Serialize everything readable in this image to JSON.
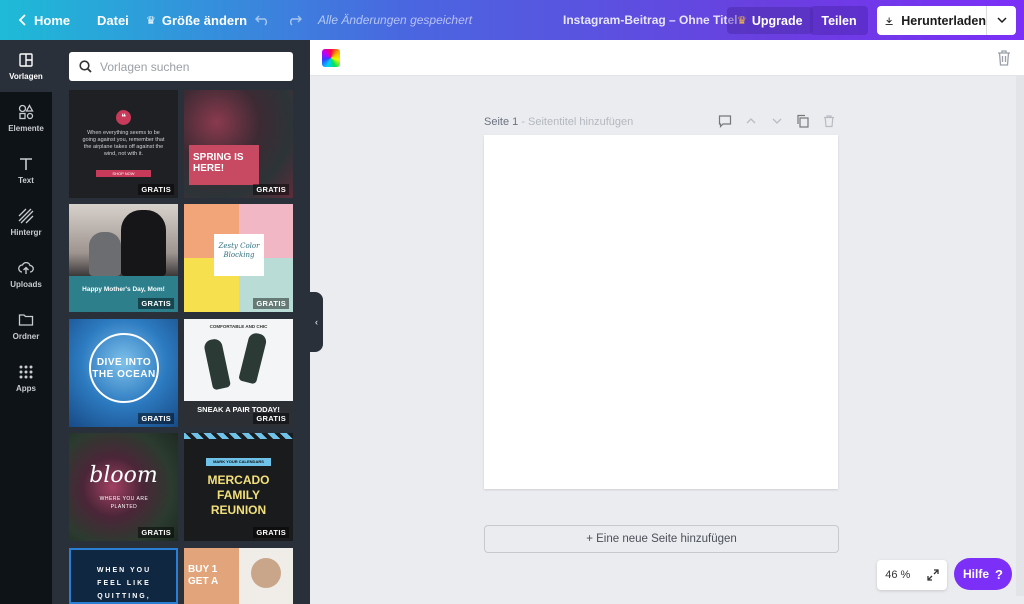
{
  "topbar": {
    "home_label": "Home",
    "file_label": "Datei",
    "resize_label": "Größe ändern",
    "saved_status": "Alle Änderungen gespeichert",
    "doc_title": "Instagram-Beitrag – Ohne Titel",
    "upgrade_label": "Upgrade",
    "share_label": "Teilen",
    "download_label": "Herunterladen"
  },
  "rail": {
    "items": [
      {
        "label": "Vorlagen",
        "icon": "template-icon"
      },
      {
        "label": "Elemente",
        "icon": "shapes-icon"
      },
      {
        "label": "Text",
        "icon": "text-icon"
      },
      {
        "label": "Hintergr",
        "icon": "background-icon"
      },
      {
        "label": "Uploads",
        "icon": "upload-icon"
      },
      {
        "label": "Ordner",
        "icon": "folder-icon"
      },
      {
        "label": "Apps",
        "icon": "apps-icon"
      }
    ]
  },
  "panel": {
    "search_placeholder": "Vorlagen suchen",
    "badge": "GRATIS",
    "templates": [
      {
        "text": "When everything seems to be going against you, remember that the airplane takes off against the wind, not with it.",
        "cta": "SHOP NOW"
      },
      {
        "text": "SPRING IS HERE!"
      },
      {
        "text": "Happy Mother's Day, Mom!"
      },
      {
        "text": "Zesty Color Blocking"
      },
      {
        "text": "DIVE INTO THE OCEAN"
      },
      {
        "text": "SNEAK A PAIR TODAY!",
        "top": "COMFORTABLE AND CHIC"
      },
      {
        "text": "bloom",
        "sub": "WHERE YOU ARE PLANTED"
      },
      {
        "text": "MERCADO FAMILY REUNION",
        "top": "MARK YOUR CALENDARS"
      },
      {
        "text": "WHEN YOU FEEL LIKE QUITTING,"
      },
      {
        "text": "BUY 1 GET A"
      }
    ]
  },
  "canvas": {
    "page_label": "Seite 1",
    "page_title_placeholder": "- Seitentitel hinzufügen",
    "add_page_label": "+ Eine neue Seite hinzufügen",
    "zoom_label": "46 %",
    "help_label": "Hilfe",
    "help_mark": "?"
  },
  "colors": {
    "accent": "#7b2ff7",
    "panel_bg": "#293039",
    "rail_bg": "#0e1318",
    "canvas_bg": "#ebecf0"
  }
}
